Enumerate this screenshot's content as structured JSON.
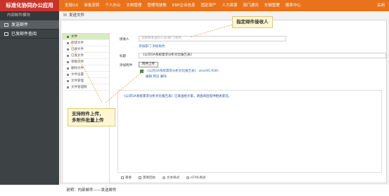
{
  "app": {
    "brand": "标准化协同办公应用",
    "close_label": "关闭"
  },
  "topnav": [
    "全部(U)",
    "审批流转",
    "个人办公",
    "文档管理",
    "管理驾驶舱",
    "ERP企业信息",
    "固定资产",
    "人力资源",
    "部门通讯",
    "车辆管理",
    "报表中心"
  ],
  "sidebar": {
    "sub": "内部邮件模块",
    "items": [
      {
        "label": "发送邮件",
        "active": true
      },
      {
        "label": "已发邮件查阅",
        "active": false
      }
    ]
  },
  "breadcrumb": "发送文件",
  "folders": [
    {
      "label": "文件",
      "selected": true
    },
    {
      "label": "新建文件",
      "selected": false
    },
    {
      "label": "已收文件",
      "selected": false
    },
    {
      "label": "已发文件",
      "selected": false
    },
    {
      "label": "草稿文件",
      "selected": false
    },
    {
      "label": "删除文件",
      "selected": false
    },
    {
      "label": "文件设置",
      "selected": false
    },
    {
      "label": "文件管理",
      "selected": false
    },
    {
      "label": "文件管理网",
      "selected": false
    }
  ],
  "form": {
    "recipients_label": "接收人",
    "recipients_placeholder": "选择要发送的人员/部门/角色",
    "recipients_links": "添加部门 添加角色",
    "title_label": "标题",
    "title_value": "《公司OA系统需求分析对比报告表》",
    "attach_label": "添加附件",
    "attach_button": "附件上传",
    "attachment_name": "《公司OA系统需求分析对比报告表》.xlsx(95.95K)",
    "attachment_actions": "编辑  预览  删除"
  },
  "editor": {
    "body": "《公司OA系统需求分析对比报告表》已发送给大家，请查阅后提供相关意见。"
  },
  "options": [
    "重要",
    "需要回执",
    "文本格式",
    "HTML格式"
  ],
  "callouts": {
    "recipients": "指定邮件接收人",
    "attachments_line1": "支持附件上传，",
    "attachments_line2": "多附件批量上传"
  },
  "footer": "说明：内部邮件——发送邮件",
  "colors": {
    "topbar": "#e8731c",
    "brand": "#c9342a",
    "sidebar": "#3d4245"
  }
}
